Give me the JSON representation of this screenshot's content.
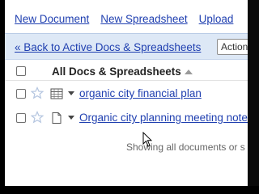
{
  "top_links": {
    "new_document": "New Document",
    "new_spreadsheet": "New Spreadsheet",
    "upload": "Upload"
  },
  "nav": {
    "back_link": "« Back to Active Docs & Spreadsheets",
    "actions_button": "Actions"
  },
  "list": {
    "header_title": "All Docs & Spreadsheets",
    "rows": [
      {
        "title": "organic city financial plan",
        "icon": "spreadsheet-icon"
      },
      {
        "title": "Organic city planning meeting notes",
        "icon": "document-icon"
      }
    ],
    "status": "Showing all documents or s"
  },
  "colors": {
    "link": "#1f3fb0",
    "nav_background": "#dde8f6"
  }
}
